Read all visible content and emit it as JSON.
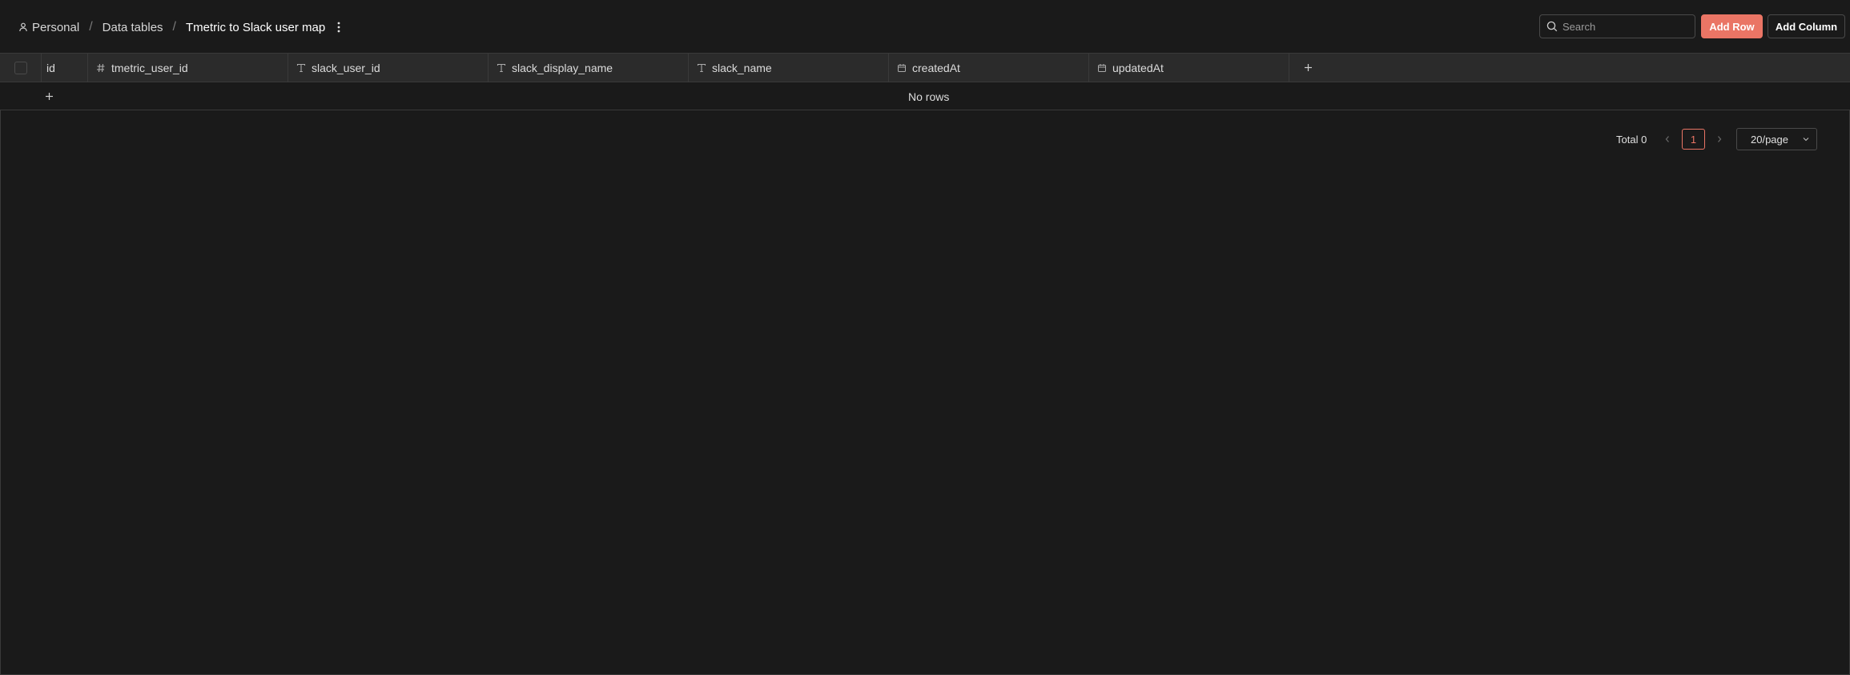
{
  "breadcrumb": {
    "personal": "Personal",
    "data_tables": "Data tables",
    "current": "Tmetric to Slack user map"
  },
  "search": {
    "placeholder": "Search"
  },
  "toolbar": {
    "add_row": "Add Row",
    "add_column": "Add Column"
  },
  "table": {
    "columns": [
      {
        "label": "id",
        "type_icon": "none"
      },
      {
        "label": "tmetric_user_id",
        "type_icon": "hash-icon"
      },
      {
        "label": "slack_user_id",
        "type_icon": "text-type-icon"
      },
      {
        "label": "slack_display_name",
        "type_icon": "text-type-icon"
      },
      {
        "label": "slack_name",
        "type_icon": "text-type-icon"
      },
      {
        "label": "createdAt",
        "type_icon": "calendar-icon"
      },
      {
        "label": "updatedAt",
        "type_icon": "calendar-icon"
      }
    ],
    "empty_text": "No rows"
  },
  "pagination": {
    "total_label": "Total 0",
    "current_page": "1",
    "page_size": "20/page"
  },
  "colors": {
    "background": "#1a1a1a",
    "header_row": "#2b2b2b",
    "accent": "#ea7565",
    "border": "#3a3a3a"
  }
}
